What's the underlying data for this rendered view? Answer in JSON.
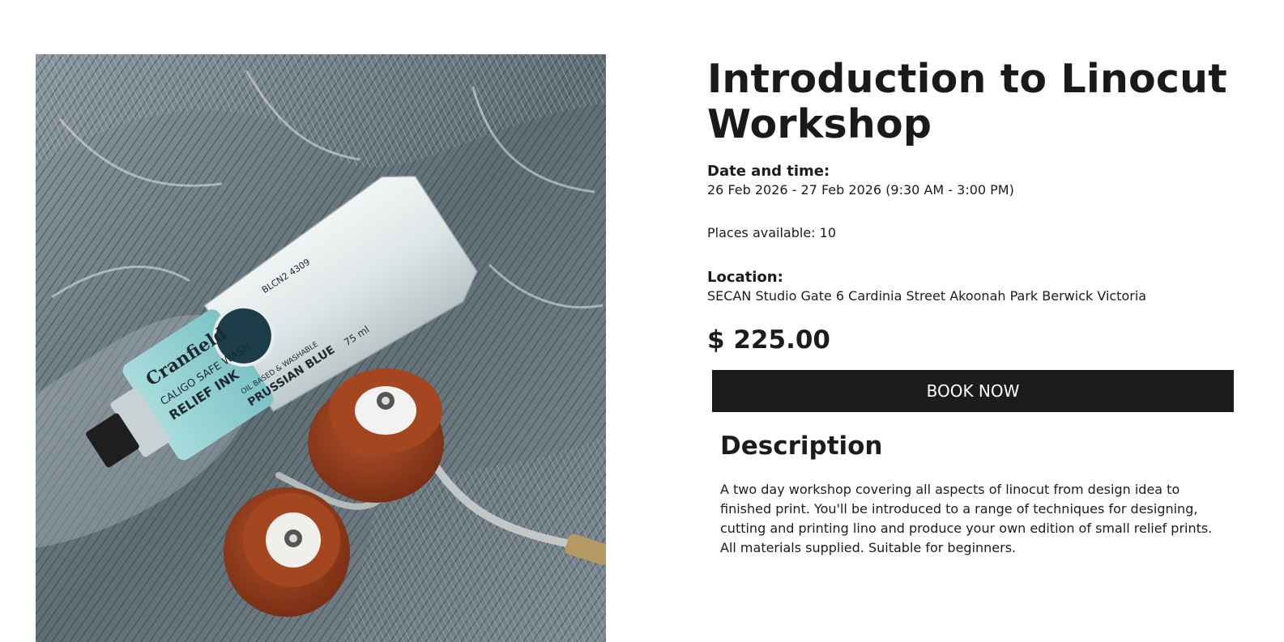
{
  "event": {
    "title": "Introduction to Linocut Workshop",
    "date_label": "Date and time:",
    "date_value": "26 Feb 2026 - 27 Feb 2026  (9:30 AM - 3:00 PM)",
    "places": "Places available: 10",
    "location_label": "Location:",
    "location_value": "SECAN Studio Gate 6 Cardinia Street Akoonah Park Berwick Victoria",
    "price": "$ 225.00",
    "book_label": "BOOK NOW"
  },
  "description": {
    "heading": "Description",
    "text": "A two day workshop covering all aspects of linocut from design idea to finished print. You'll be introduced to a range of techniques for designing, cutting and printing lino and produce your own edition of small relief prints. All materials supplied. Suitable for beginners."
  },
  "image": {
    "tube_brand": "Cranfield",
    "tube_text_1": "CALIGO SAFE WASH",
    "tube_text_2": "RELIEF INK",
    "tube_text_3": "OIL BASED & WASHABLE",
    "tube_text_4": "PRUSSIAN BLUE",
    "tube_text_5": "BLCN2 4309",
    "tube_text_6": "75 ml"
  },
  "colors": {
    "button_bg": "#1c1c1c",
    "text": "#1c1c1c",
    "ink_teal": "#8fcfd2",
    "roller_brown": "#9a3e1e"
  }
}
